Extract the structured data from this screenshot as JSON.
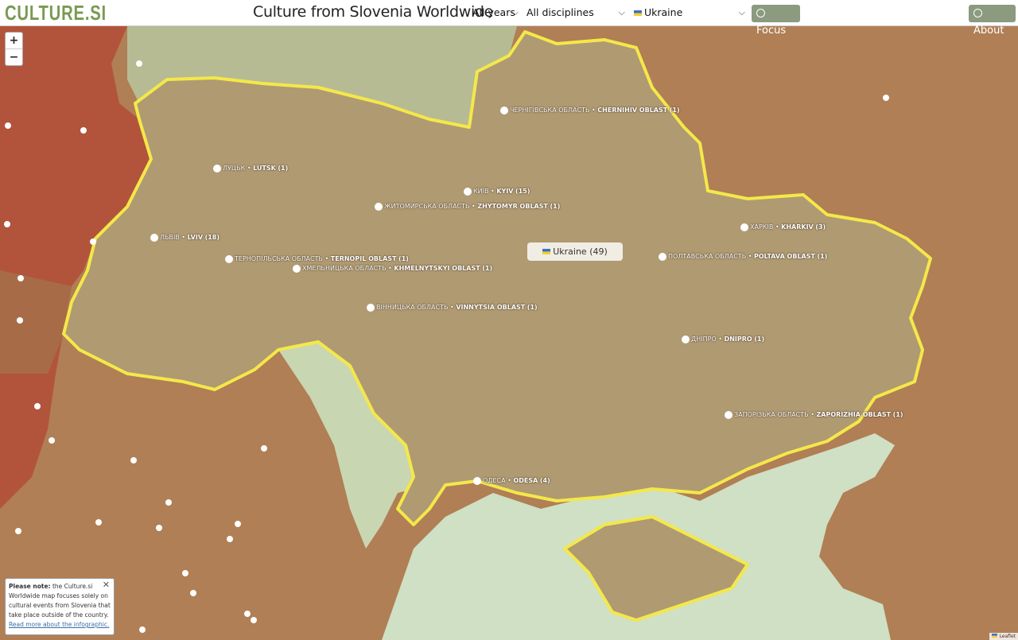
{
  "header": {
    "logo": "CULTURE.SI",
    "title": "Culture from Slovenia Worldwide",
    "year_select": "All years",
    "discipline_select": "All disciplines",
    "country_select": "Ukraine",
    "focus_label": "Focus",
    "about_label": "About"
  },
  "zoom": {
    "in": "+",
    "out": "−"
  },
  "country_badge": "Ukraine (49)",
  "markers": [
    {
      "native": "ЧЕРНІГІВСЬКА ОБЛАСТЬ",
      "latin": "CHERNIHIV OBLAST",
      "count": "(1)"
    },
    {
      "native": "ЛУЦЬК",
      "latin": "LUTSK",
      "count": "(1)"
    },
    {
      "native": "КИЇВ",
      "latin": "KYIV",
      "count": "(15)"
    },
    {
      "native": "ЖИТОМИРСЬКА ОБЛАСТЬ",
      "latin": "ZHYTOMYR OBLAST",
      "count": "(1)"
    },
    {
      "native": "ЛЬВІВ",
      "latin": "LVIV",
      "count": "(18)"
    },
    {
      "native": "ТЕРНОПІЛЬСЬКА ОБЛАСТЬ",
      "latin": "TERNOPIL OBLAST",
      "count": "(1)"
    },
    {
      "native": "ХМЕЛЬНИЦЬКА ОБЛАСТЬ",
      "latin": "KHMELNYTSKYI OBLAST",
      "count": "(1)"
    },
    {
      "native": "ХАРКІВ",
      "latin": "KHARKIV",
      "count": "(3)"
    },
    {
      "native": "ПОЛТАВСЬКА ОБЛАСТЬ",
      "latin": "POLTAVA OBLAST",
      "count": "(1)"
    },
    {
      "native": "ВІННИЦЬКА ОБЛАСТЬ",
      "latin": "VINNYTSIA OBLAST",
      "count": "(1)"
    },
    {
      "native": "ДНІПРО",
      "latin": "DNIPRO",
      "count": "(1)"
    },
    {
      "native": "ЗАПОРІЗЬКА ОБЛАСТЬ",
      "latin": "ZAPORIZHIA OBLAST",
      "count": "(1)"
    },
    {
      "native": "ОДЕСА",
      "latin": "ODESA",
      "count": "(4)"
    }
  ],
  "note": {
    "bold": "Please note:",
    "text": "the Culture.si Worldwide map focuses solely on cultural events from Slovenia that take place outside of the country.",
    "link": "Read more about the infographic."
  },
  "attribution": "Leaflet",
  "colors": {
    "highlight_border": "#f4e84a",
    "ukraine_fill": "#b09a72",
    "sea": "#cfe0c4",
    "belarus": "#b7bb93",
    "poland": "#b2543b"
  }
}
